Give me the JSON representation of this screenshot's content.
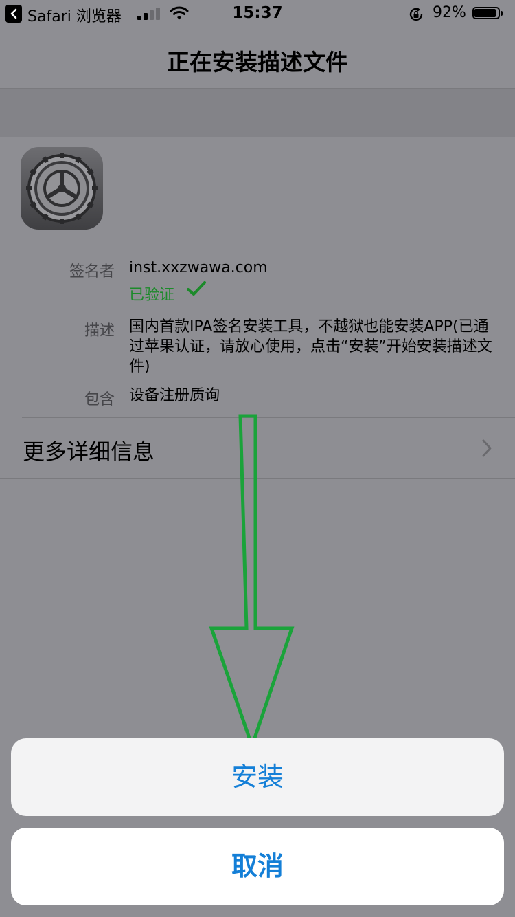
{
  "status_bar": {
    "back_app_label": "Safari 浏览器",
    "time": "15:37",
    "battery_percent": "92%",
    "battery_level": 0.92,
    "signal_bars_filled": 2,
    "signal_bars_total": 4
  },
  "nav": {
    "title": "正在安装描述文件"
  },
  "profile": {
    "icon": "settings-gear-icon",
    "signer_label": "签名者",
    "signer_value": "inst.xxzwawa.com",
    "verified_label": "已验证",
    "description_label": "描述",
    "description_lines": [
      "国内首款IPA签名安装工具，不越狱也能安装APP(已通",
      "过苹果认证，请放心使用，点击“安装”开始安装描述文",
      "件)"
    ],
    "contains_label": "包含",
    "contains_value": "设备注册质询",
    "more_info": "更多详细信息"
  },
  "action_sheet": {
    "install_label": "安装",
    "cancel_label": "取消"
  },
  "colors": {
    "dim_background": "#8e8e93",
    "verified_green": "#1c8a2a",
    "action_blue": "#147fd7",
    "annotation_arrow": "#1aa33a"
  }
}
